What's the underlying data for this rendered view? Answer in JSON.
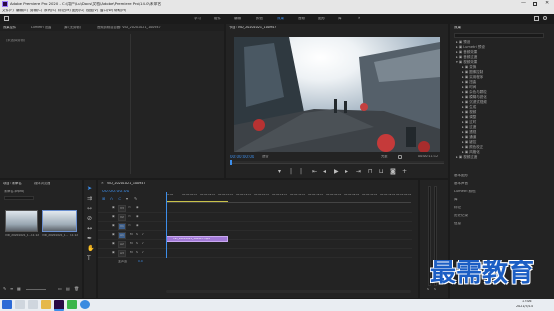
{
  "titlebar": {
    "title": "Adobe Premiere Pro 2020 - C:\\用户\\Lu\\Docs\\文档\\Adobe\\Premiere Pro\\14.0\\未命名"
  },
  "menubar": [
    "文件(F)",
    "编辑(E)",
    "剪辑(C)",
    "序列(S)",
    "标记(M)",
    "图形(G)",
    "视图(V)",
    "窗口(W)",
    "帮助(H)"
  ],
  "workspaces": [
    "学习",
    "组件",
    "编辑",
    "颜色",
    "效果",
    "音频",
    "图形",
    "库"
  ],
  "active_workspace": "效果",
  "source_panel": {
    "tabs": [
      "效果控件",
      "Lumetri 范围",
      "源:(无剪辑)",
      "音频剪辑混合器: VID_20201021_100947"
    ],
    "placeholder": "(未选择剪辑)"
  },
  "program_monitor": {
    "tab": "节目: VID_20201021_100947",
    "timecode": "00:00:00:00",
    "fit": "适合",
    "quality": "完整",
    "duration": "00:00:11:12"
  },
  "effects_panel": {
    "title": "效果",
    "tree": [
      "预设",
      "Lumetri 预设",
      "音频效果",
      "音频过渡",
      "视频效果",
      "变换",
      "图像控制",
      "实用程序",
      "扭曲",
      "时间",
      "杂色与颗粒",
      "模糊与锐化",
      "沉浸式视频",
      "生成",
      "视频",
      "调整",
      "过时",
      "过渡",
      "透视",
      "通道",
      "键控",
      "颜色校正",
      "风格化",
      "视频过渡"
    ],
    "lower": [
      "基本图形",
      "基本声音",
      "Lumetri 颜色",
      "库",
      "标记",
      "历史记录",
      "信息"
    ]
  },
  "project_panel": {
    "tabs": [
      "项目: 未命名",
      "媒体浏览器"
    ],
    "name": "未命名.prproj",
    "items": [
      {
        "name": "VID_20201021_1...",
        "duration": "11:12"
      },
      {
        "name": "VID_20201021_1...",
        "duration": "11:12"
      }
    ]
  },
  "timeline": {
    "tab": "VID_20201021_100947",
    "timecode": "00:00:00:00",
    "ruler": [
      "00:00",
      "00:00:04:23",
      "00:00:09:23",
      "00:00:14:23",
      "00:00:19:23",
      "00:00:24:23",
      "00:00:29:23",
      "00:00:34:23",
      "00:00:39:23",
      "00:00:44:22",
      "00:00:49:22",
      "00:00:54:22",
      "00:00:59:22",
      "00:01:04:22"
    ],
    "tracks": [
      "V3",
      "V2",
      "V1",
      "A1",
      "A2",
      "A3"
    ],
    "master": "主声道",
    "master_value": "0.0",
    "clip": "VID_20201021_100947.mp4"
  },
  "watermark": "最需教育",
  "taskbar": {
    "time": "17:06",
    "date": "2021/5/14"
  }
}
